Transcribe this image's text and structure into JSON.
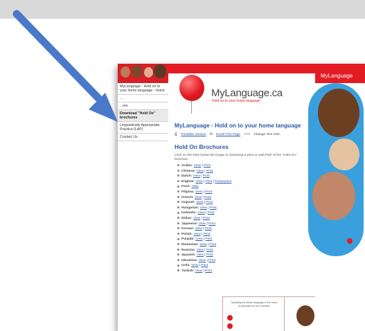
{
  "logo": {
    "name": "MyLanguage.ca",
    "tagline": "Hold on to your home language"
  },
  "right_banner": "MyLanguage",
  "nav": {
    "items": [
      {
        "label": "MyLanguage - Hold on to your home language - home"
      },
      {
        "label": "..."
      },
      {
        "label": "...res"
      },
      {
        "label": "Download \"Hold On\" brochures"
      },
      {
        "label": "Linguistically Appropriate Practice (LAP)"
      },
      {
        "label": "Contact Us"
      }
    ]
  },
  "page": {
    "title": "MyLanguage - Hold on to your home language",
    "printable": "Printable Version",
    "email": "Email This Page",
    "text_size": "Change Text Size",
    "section_title": "Hold On Brochures",
    "intro": "Click on the links below the image to download a print or web PDF of the \"Hold On\" brochure."
  },
  "languages": [
    {
      "name": "Arabic:",
      "links": [
        "View",
        "Print"
      ]
    },
    {
      "name": "Chinese:",
      "links": [
        "View",
        "Print"
      ]
    },
    {
      "name": "Dutch:",
      "links": [
        "View",
        "Print"
      ]
    },
    {
      "name": "English:",
      "links": [
        "View",
        "Print",
        "Powerpoint"
      ]
    },
    {
      "name": "Farsi:",
      "links": [
        "View"
      ]
    },
    {
      "name": "Filipino:",
      "links": [
        "View",
        "Print"
      ]
    },
    {
      "name": "French:",
      "links": [
        "View",
        "Print"
      ]
    },
    {
      "name": "Gujarati:",
      "links": [
        "View",
        "Print"
      ]
    },
    {
      "name": "Hungarian:",
      "links": [
        "View",
        "Print"
      ]
    },
    {
      "name": "Icelandic:",
      "links": [
        "View",
        "Print"
      ]
    },
    {
      "name": "Italian:",
      "links": [
        "View",
        "Print"
      ]
    },
    {
      "name": "Japanese:",
      "links": [
        "View",
        "Print"
      ]
    },
    {
      "name": "Korean:",
      "links": [
        "View",
        "Print"
      ]
    },
    {
      "name": "Polish:",
      "links": [
        "View",
        "Print"
      ]
    },
    {
      "name": "Punjabi:",
      "links": [
        "View",
        "Print"
      ]
    },
    {
      "name": "Romanian:",
      "links": [
        "View",
        "Print"
      ]
    },
    {
      "name": "Russian:",
      "links": [
        "View",
        "Print"
      ]
    },
    {
      "name": "Spanish:",
      "links": [
        "View",
        "Print"
      ]
    },
    {
      "name": "Ukrainian:",
      "links": [
        "View",
        "Print"
      ]
    },
    {
      "name": "Urdu:",
      "links": [
        "View",
        "Print"
      ]
    },
    {
      "name": "Turkish:",
      "links": [
        "View",
        "Print"
      ]
    }
  ],
  "brochure": {
    "text": "Speaking the family language in the home is important for your children!"
  },
  "colors": {
    "brand_red": "#e31b23",
    "link_blue": "#2a5aa8",
    "arrow_blue": "#4a79c9"
  },
  "icons": {
    "arrow": "pointer-arrow-icon",
    "balloon": "balloon-logo-icon",
    "printer": "printer-icon",
    "email": "email-icon"
  }
}
